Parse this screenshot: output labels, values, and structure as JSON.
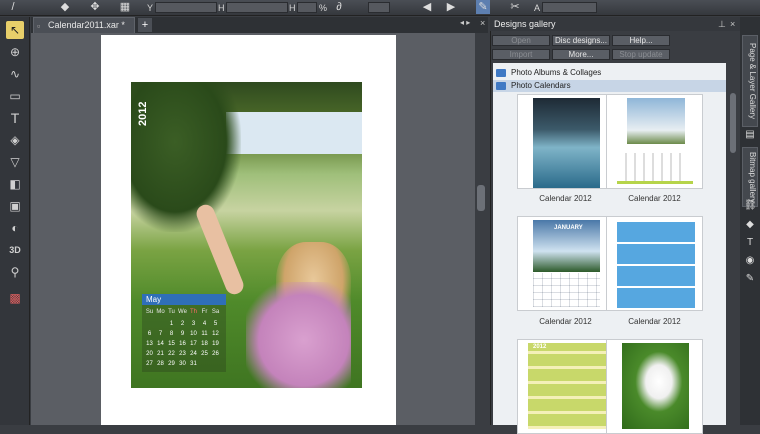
{
  "toolbar": {
    "label_y": "Y",
    "label_h": "H",
    "label_h_pct": "H",
    "pct": "%",
    "label_a": "A"
  },
  "tools": [
    "selector-tool",
    "zoom-tool",
    "freehand-tool",
    "rectangle-tool",
    "text-tool",
    "fill-tool",
    "transparency-tool",
    "shadow-tool",
    "bevel-tool",
    "mould-tool",
    "3d-tool",
    "zoom-lens-tool",
    "live-effects-tool"
  ],
  "document": {
    "tab_label": "Calendar2011.xar *",
    "add_tab": "+"
  },
  "calendar": {
    "year": "2012",
    "month": "May",
    "day_heads": [
      "Su",
      "Mo",
      "Tu",
      "We",
      "Th",
      "Fr",
      "Sa"
    ],
    "weeks": [
      [
        "",
        "",
        "1",
        "2",
        "3",
        "4",
        "5"
      ],
      [
        "6",
        "7",
        "8",
        "9",
        "10",
        "11",
        "12"
      ],
      [
        "13",
        "14",
        "15",
        "16",
        "17",
        "18",
        "19"
      ],
      [
        "20",
        "21",
        "22",
        "23",
        "24",
        "25",
        "26"
      ],
      [
        "27",
        "28",
        "29",
        "30",
        "31",
        "",
        ""
      ]
    ]
  },
  "gallery": {
    "title": "Designs gallery",
    "buttons": {
      "open": "Open",
      "disc": "Disc designs...",
      "help": "Help...",
      "import": "Import",
      "more": "More...",
      "stop": "Stop update"
    },
    "folders": [
      "Photo Albums & Collages",
      "Photo Calendars"
    ],
    "items": [
      {
        "caption": "Calendar 2012"
      },
      {
        "caption": "Calendar 2012"
      },
      {
        "caption": "Calendar 2012"
      },
      {
        "caption": "Calendar 2012"
      }
    ],
    "thumb_text": {
      "january": "JANUARY",
      "year2012": "2012"
    }
  },
  "dock": {
    "page_layer": "Page & Layer Gallery",
    "bitmap": "Bitmap gallery"
  }
}
